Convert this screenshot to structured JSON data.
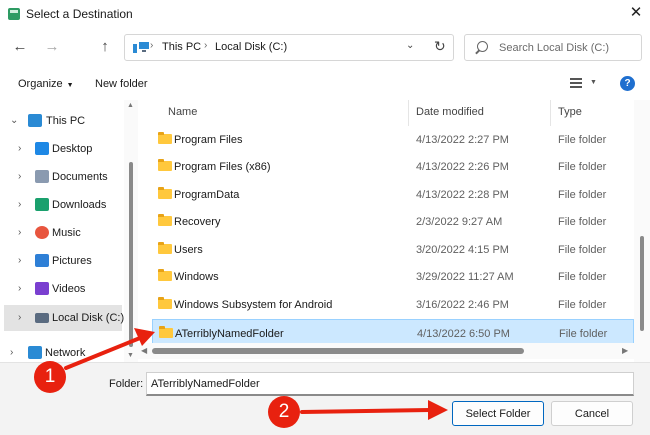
{
  "window": {
    "title": "Select a Destination"
  },
  "nav": {
    "breadcrumb": [
      {
        "label": "This PC"
      },
      {
        "label": "Local Disk (C:)"
      }
    ],
    "search_placeholder": "Search Local Disk (C:)"
  },
  "toolbar": {
    "organize_label": "Organize",
    "new_folder_label": "New folder"
  },
  "sidebar": {
    "items": [
      {
        "label": "This PC",
        "icon": "monitor-icon",
        "color": "#2a8ad4"
      },
      {
        "label": "Desktop",
        "icon": "desktop-icon",
        "color": "#1e88e5"
      },
      {
        "label": "Documents",
        "icon": "document-icon",
        "color": "#8a9ab0"
      },
      {
        "label": "Downloads",
        "icon": "download-icon",
        "color": "#1aa06d"
      },
      {
        "label": "Music",
        "icon": "music-icon",
        "color": "#e8553e"
      },
      {
        "label": "Pictures",
        "icon": "picture-icon",
        "color": "#2e7fd6"
      },
      {
        "label": "Videos",
        "icon": "video-icon",
        "color": "#7a3fd0"
      },
      {
        "label": "Local Disk (C:)",
        "icon": "drive-icon",
        "color": "#5a6b80"
      },
      {
        "label": "Network",
        "icon": "network-icon",
        "color": "#2a8ad4"
      }
    ]
  },
  "columns": {
    "name": "Name",
    "date": "Date modified",
    "type": "Type"
  },
  "rows": [
    {
      "name": "Program Files",
      "date": "4/13/2022 2:27 PM",
      "type": "File folder"
    },
    {
      "name": "Program Files (x86)",
      "date": "4/13/2022 2:26 PM",
      "type": "File folder"
    },
    {
      "name": "ProgramData",
      "date": "4/13/2022 2:28 PM",
      "type": "File folder"
    },
    {
      "name": "Recovery",
      "date": "2/3/2022 9:27 AM",
      "type": "File folder"
    },
    {
      "name": "Users",
      "date": "3/20/2022 4:15 PM",
      "type": "File folder"
    },
    {
      "name": "Windows",
      "date": "3/29/2022 11:27 AM",
      "type": "File folder"
    },
    {
      "name": "Windows Subsystem for Android",
      "date": "3/16/2022 2:46 PM",
      "type": "File folder"
    },
    {
      "name": "ATerriblyNamedFolder",
      "date": "4/13/2022 6:50 PM",
      "type": "File folder"
    }
  ],
  "footer": {
    "folder_label": "Folder:",
    "folder_value": "ATerriblyNamedFolder",
    "select_label": "Select Folder",
    "cancel_label": "Cancel"
  },
  "annotations": {
    "badge1": "1",
    "badge2": "2",
    "color": "#e8210f"
  },
  "colors": {
    "selection": "#cce8ff",
    "accent": "#0067c0",
    "folder": "#ffc83d"
  }
}
